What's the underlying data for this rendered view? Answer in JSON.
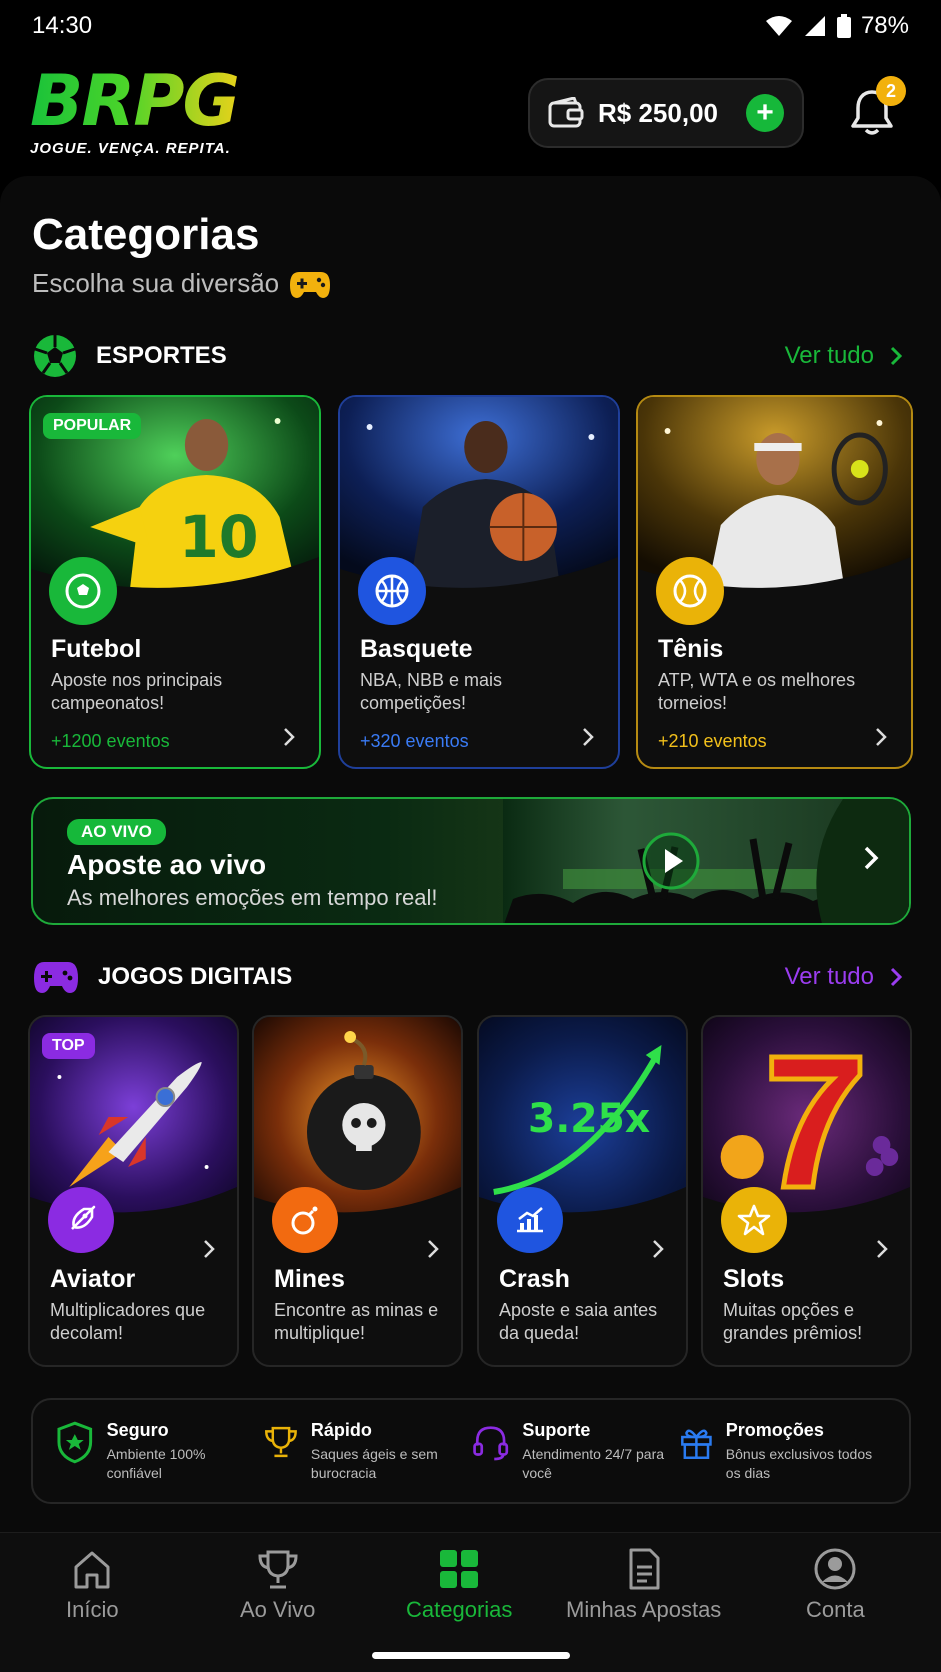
{
  "status_bar": {
    "time": "14:30",
    "battery": "78%"
  },
  "header": {
    "logo_text": "BRPG",
    "logo_tagline": "JOGUE. VENÇA. REPITA.",
    "balance": "R$ 250,00",
    "notifications_count": "2"
  },
  "page": {
    "title": "Categorias",
    "subtitle": "Escolha sua diversão"
  },
  "sports": {
    "section_title": "ESPORTES",
    "see_all": "Ver tudo",
    "cards": [
      {
        "badge": "POPULAR",
        "name": "Futebol",
        "desc": "Aposte nos principais campeonatos!",
        "events": "+1200 eventos",
        "color": "#19b83a"
      },
      {
        "name": "Basquete",
        "desc": "NBA, NBB e mais competições!",
        "events": "+320 eventos",
        "color": "#1f55e0"
      },
      {
        "name": "Tênis",
        "desc": "ATP, WTA e os melhores torneios!",
        "events": "+210 eventos",
        "color": "#eab308"
      }
    ]
  },
  "live_banner": {
    "badge": "AO VIVO",
    "title": "Aposte ao vivo",
    "subtitle": "As melhores emoções em tempo real!"
  },
  "games": {
    "section_title": "JOGOS DIGITAIS",
    "see_all": "Ver tudo",
    "cards": [
      {
        "badge": "TOP",
        "name": "Aviator",
        "desc": "Multiplicadores que decolam!",
        "color": "#8b2be2"
      },
      {
        "name": "Mines",
        "desc": "Encontre as minas e multiplique!",
        "color": "#f26a10"
      },
      {
        "name": "Crash",
        "desc": "Aposte e saia antes da queda!",
        "color": "#1f55e0",
        "multiplier": "3.25x"
      },
      {
        "name": "Slots",
        "desc": "Muitas opções e grandes prêmios!",
        "color": "#eab308"
      }
    ]
  },
  "features": [
    {
      "title": "Seguro",
      "desc": "Ambiente 100% confiável",
      "color": "#19b83a"
    },
    {
      "title": "Rápido",
      "desc": "Saques ágeis e sem burocracia",
      "color": "#eab308"
    },
    {
      "title": "Suporte",
      "desc": "Atendimento 24/7 para você",
      "color": "#8b2be2"
    },
    {
      "title": "Promoções",
      "desc": "Bônus exclusivos todos os dias",
      "color": "#2a7bf0"
    }
  ],
  "nav": [
    {
      "label": "Início",
      "active": false
    },
    {
      "label": "Ao Vivo",
      "active": false
    },
    {
      "label": "Categorias",
      "active": true
    },
    {
      "label": "Minhas Apostas",
      "active": false
    },
    {
      "label": "Conta",
      "active": false
    }
  ],
  "colors": {
    "accent_green": "#19b83a",
    "accent_purple": "#8b2be2",
    "background": "#000000"
  }
}
